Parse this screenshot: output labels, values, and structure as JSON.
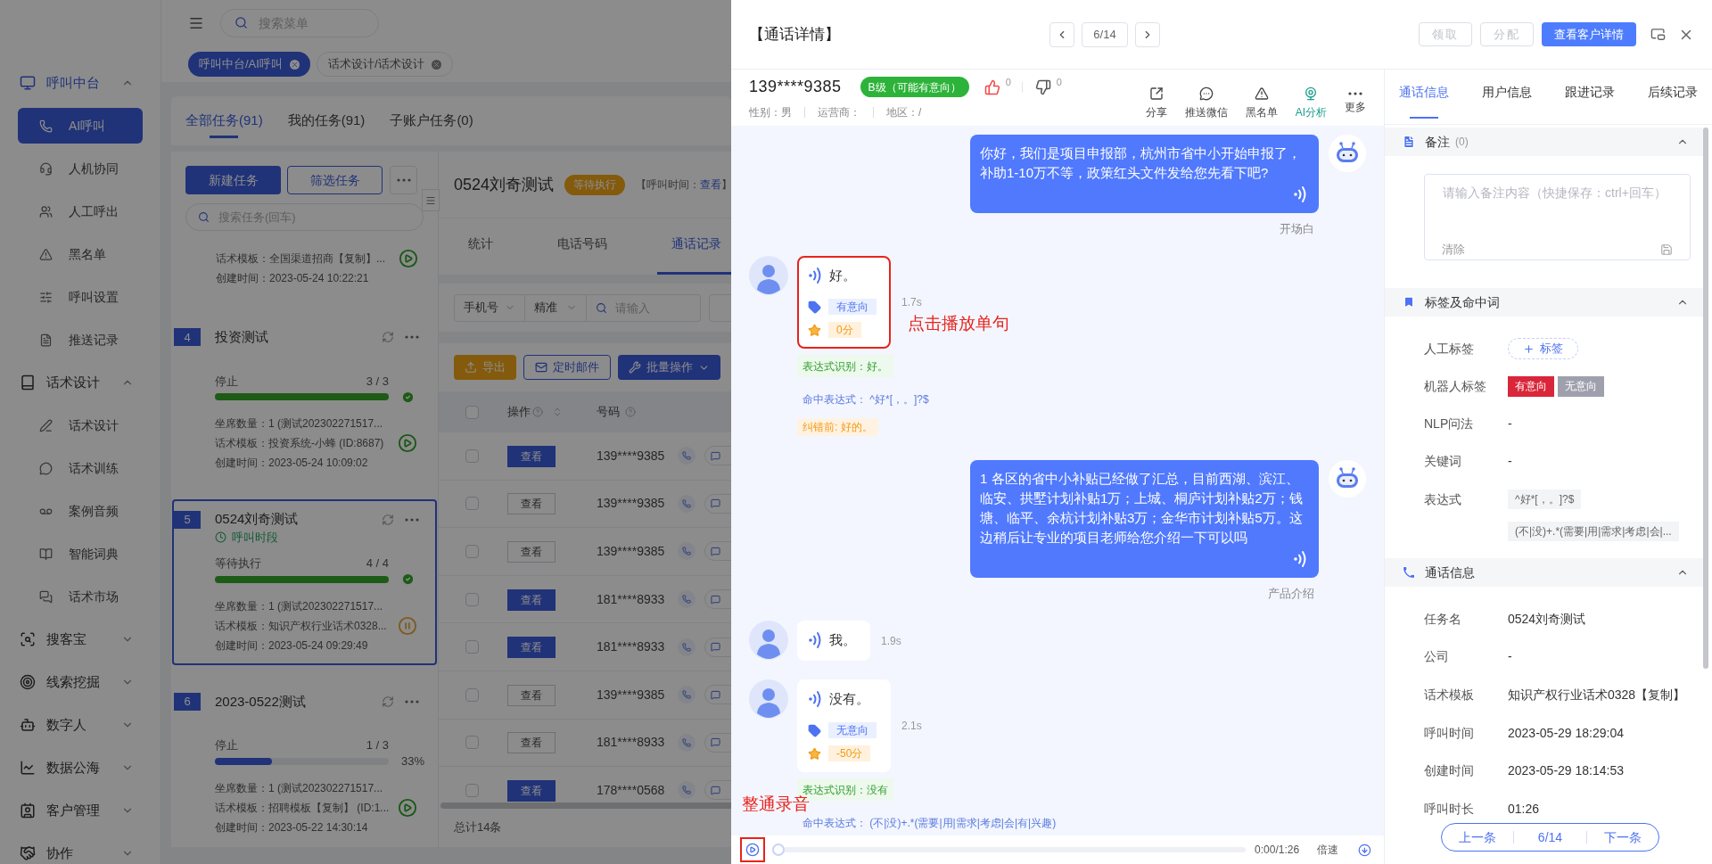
{
  "sidebar": {
    "groups": [
      {
        "label": "呼叫中台",
        "expanded": true,
        "children": [
          {
            "label": "AI呼叫",
            "selected": true
          },
          {
            "label": "人机协同",
            "selected": false
          },
          {
            "label": "人工呼出",
            "selected": false
          },
          {
            "label": "黑名单",
            "selected": false
          },
          {
            "label": "呼叫设置",
            "selected": false
          },
          {
            "label": "推送记录",
            "selected": false
          }
        ]
      },
      {
        "label": "话术设计",
        "expanded": true,
        "children": [
          {
            "label": "话术设计",
            "selected": false
          },
          {
            "label": "话术训练",
            "selected": false
          },
          {
            "label": "案例音频",
            "selected": false
          },
          {
            "label": "智能词典",
            "selected": false
          },
          {
            "label": "话术市场",
            "selected": false
          }
        ]
      },
      {
        "label": "搜客宝",
        "expanded": false
      },
      {
        "label": "线索挖掘",
        "expanded": false
      },
      {
        "label": "数字人",
        "expanded": false
      },
      {
        "label": "数据公海",
        "expanded": false
      },
      {
        "label": "客户管理",
        "expanded": false
      },
      {
        "label": "协作",
        "expanded": false
      }
    ]
  },
  "header": {
    "search": {
      "placeholder": "搜索菜单"
    }
  },
  "page_tabs": [
    {
      "label": "呼叫中台/AI呼叫",
      "selected": true
    },
    {
      "label": "话术设计/话术设计",
      "selected": false
    }
  ],
  "task_tabs": [
    {
      "label": "全部任务(91)",
      "selected": true
    },
    {
      "label": "我的任务(91)",
      "selected": false
    },
    {
      "label": "子账户任务(0)",
      "selected": false
    }
  ],
  "task_panel": {
    "buttons": [
      "新建任务",
      "筛选任务"
    ],
    "search": {
      "placeholder": "搜索任务(回车)"
    },
    "tasks": [
      {
        "selected": false,
        "template": "话术模板：全国渠道招商【复制】...",
        "created": "创建时间：2023-05-24 10:22:21",
        "paused": false
      },
      {
        "selected": false,
        "number": "4",
        "title": "投资测试",
        "status": "停止",
        "count": "3 / 3",
        "level": 1,
        "complete": true,
        "seats": "坐席数量：1 (测试202302271517...",
        "template": "话术模板：投资系统-小蜂 (ID:8687)",
        "created": "创建时间：2023-05-24 10:09:02",
        "paused": false
      },
      {
        "selected": true,
        "number": "5",
        "title": "0524刘奇测试",
        "call_window": "呼叫时段",
        "status": "等待执行",
        "count": "4 / 4",
        "level": 1,
        "complete": true,
        "seats": "坐席数量：1 (测试202302271517...",
        "template": "话术模板：知识产权行业话术0328...",
        "created": "创建时间：2023-05-24 09:29:49",
        "paused": true
      },
      {
        "selected": false,
        "number": "6",
        "title": "2023-0522测试",
        "status": "停止",
        "count": "1 / 3",
        "level": 0.33,
        "complete": false,
        "percent": "33%",
        "seats": "坐席数量：1 (测试202302271517...",
        "template": "话术模板：招聘模板【复制】 (ID:1...",
        "created": "创建时间：2023-05-22 14:30:14",
        "paused": false
      }
    ]
  },
  "task_detail": {
    "title": "0524刘奇测试",
    "status": "等待执行",
    "call_time": {
      "label": "【呼叫时间：",
      "link": "查看",
      "suffix": "】"
    },
    "tabs": [
      {
        "label": "统计",
        "selected": false
      },
      {
        "label": "电话号码",
        "selected": false
      },
      {
        "label": "通话记录",
        "selected": true
      }
    ],
    "filters": {
      "field": "手机号",
      "match": "精准",
      "search": {
        "placeholder": "请输入"
      }
    },
    "actions": [
      {
        "label": "导出",
        "kind": "export"
      },
      {
        "label": "定时邮件",
        "kind": "mail"
      },
      {
        "label": "批量操作",
        "kind": "batch"
      }
    ],
    "table": {
      "columns": [
        "操作",
        "号码"
      ],
      "select_all": {
        "checked": false
      },
      "rows": [
        {
          "checked": false,
          "action": "查看",
          "primary": true,
          "phone": "139****9385"
        },
        {
          "checked": false,
          "action": "查看",
          "primary": false,
          "phone": "139****9385"
        },
        {
          "checked": false,
          "action": "查看",
          "primary": false,
          "phone": "139****9385"
        },
        {
          "checked": false,
          "action": "查看",
          "primary": true,
          "phone": "181****8933"
        },
        {
          "checked": false,
          "action": "查看",
          "primary": true,
          "phone": "181****8933"
        },
        {
          "checked": false,
          "action": "查看",
          "primary": false,
          "phone": "139****9385"
        },
        {
          "checked": false,
          "action": "查看",
          "primary": false,
          "phone": "181****8933"
        },
        {
          "checked": false,
          "action": "查看",
          "primary": true,
          "phone": "178****0568"
        }
      ]
    },
    "total": "总计14条"
  },
  "drawer": {
    "title": "【通话详情】",
    "pager": "6/14",
    "buttons": [
      {
        "label": "领取",
        "disabled": true
      },
      {
        "label": "分配",
        "disabled": true
      },
      {
        "label": "查看客户详情",
        "disabled": false
      }
    ],
    "call": {
      "phone": "139****9385",
      "grade": "B级（可能有意向）",
      "likes": "0",
      "dislikes": "0",
      "meta": [
        "性别：男",
        "运营商：",
        "地区：/"
      ],
      "actions": [
        {
          "label": "分享",
          "active": false
        },
        {
          "label": "推送微信",
          "active": false
        },
        {
          "label": "黑名单",
          "active": false
        },
        {
          "label": "AI分析",
          "active": true
        },
        {
          "label": "更多",
          "active": false
        }
      ]
    },
    "messages": [
      {
        "kind": "bot",
        "text": "你好，我们是项目申报部，杭州市省中小开始申报了，补助1-10万不等，政策红头文件发给您先看下吧?",
        "label": "开场白"
      },
      {
        "kind": "user",
        "text": "好。",
        "intent": "有意向",
        "score": "0分",
        "duration": "1.7s",
        "highlighted": true,
        "annotation": "点击播放单句",
        "recognition": "表达式识别：好。",
        "match": "命中表达式： ^好*[，。]?$",
        "correction": "纠错前: 好的。"
      },
      {
        "kind": "bot",
        "text": "1 各区的省中小补贴已经做了汇总，目前西湖、滨江、临安、拱墅计划补贴1万；上城、桐庐计划补贴2万；钱塘、临平、余杭计划补贴3万；金华市计划补贴5万。这边稍后让专业的项目老师给您介绍一下可以吗",
        "label": "产品介绍"
      },
      {
        "kind": "user",
        "text": "我。",
        "duration": "1.9s",
        "highlighted": false
      },
      {
        "kind": "user",
        "text": "没有。",
        "intent": "无意向",
        "score": "-50分",
        "duration": "2.1s",
        "highlighted": false,
        "recognition": "表达式识别：没有",
        "match": "命中表达式： (不|没)+.*(需要|用|需求|考虑|会|有|兴趣)"
      }
    ],
    "player": {
      "time": "0:00/1:26",
      "speed": "倍速",
      "level": 0,
      "highlighted": true,
      "annotation": "整通录音"
    },
    "info_tabs": [
      {
        "label": "通话信息",
        "selected": true
      },
      {
        "label": "用户信息",
        "selected": false
      },
      {
        "label": "跟进记录",
        "selected": false
      },
      {
        "label": "后续记录",
        "selected": false
      }
    ],
    "notes": {
      "title": "备注",
      "count": "(0)",
      "expanded": true,
      "placeholder": "请输入备注内容（快捷保存：ctrl+回车）",
      "clear": "清除"
    },
    "tags": {
      "title": "标签及命中词",
      "expanded": true,
      "rows": [
        {
          "kind": "add",
          "label": "人工标签",
          "button": "标签"
        },
        {
          "kind": "tags",
          "label": "机器人标签",
          "tags": [
            {
              "text": "有意向",
              "selected": true
            },
            {
              "text": "无意向",
              "selected": false
            }
          ]
        },
        {
          "kind": "text",
          "label": "NLP问法",
          "value": "-"
        },
        {
          "kind": "text",
          "label": "关键词",
          "value": "-"
        },
        {
          "kind": "chips",
          "label": "表达式",
          "chips": [
            "^好*[，。]?$",
            "(不|没)+.*(需要|用|需求|考虑|会|..."
          ]
        }
      ]
    },
    "call_info": {
      "title": "通话信息",
      "expanded": true,
      "rows": [
        {
          "label": "任务名",
          "value": "0524刘奇测试"
        },
        {
          "label": "公司",
          "value": "-"
        },
        {
          "label": "话术模板",
          "value": "知识产权行业话术0328【复制】"
        },
        {
          "label": "呼叫时间",
          "value": "2023-05-29 18:29:04"
        },
        {
          "label": "创建时间",
          "value": "2023-05-29 18:14:53"
        },
        {
          "label": "呼叫时长",
          "value": "01:26"
        }
      ]
    },
    "footer_pager": {
      "prev": "上一条",
      "position": "6/14",
      "next": "下一条"
    }
  }
}
